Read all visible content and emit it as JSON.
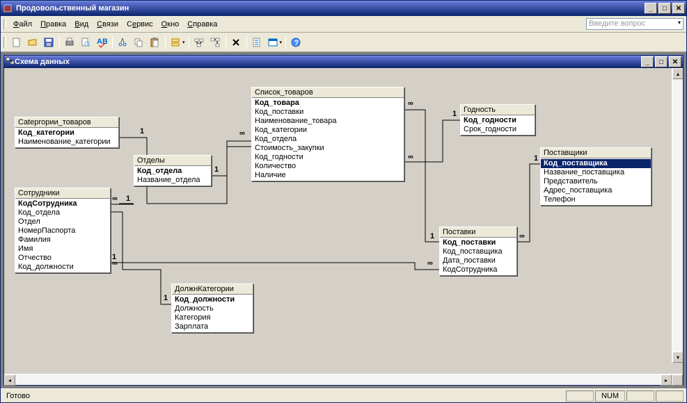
{
  "window": {
    "title": "Продовольственный магазин",
    "min": "_",
    "max": "□",
    "close": "✕"
  },
  "menu": {
    "items": [
      {
        "pre": "",
        "ul": "Ф",
        "post": "айл"
      },
      {
        "pre": "",
        "ul": "П",
        "post": "равка"
      },
      {
        "pre": "",
        "ul": "В",
        "post": "ид"
      },
      {
        "pre": "",
        "ul": "С",
        "post": "вязи"
      },
      {
        "pre": "С",
        "ul": "е",
        "post": "рвис"
      },
      {
        "pre": "",
        "ul": "О",
        "post": "кно"
      },
      {
        "pre": "",
        "ul": "С",
        "post": "правка"
      }
    ],
    "question_placeholder": "Введите вопрос"
  },
  "child": {
    "title": "Схема данных",
    "min": "_",
    "max": "□",
    "close": "✕"
  },
  "tables": {
    "cat": {
      "title": "Catергории_товаров",
      "fields": [
        "Код_категории",
        "Наименование_категории"
      ],
      "pk": [
        0
      ]
    },
    "otd": {
      "title": "Отделы",
      "fields": [
        "Код_отдела",
        "Название_отдела"
      ],
      "pk": [
        0
      ]
    },
    "sotr": {
      "title": "Сотрудники",
      "fields": [
        "КодСотрудника",
        "Код_отдела",
        "Отдел",
        "НомерПаспорта",
        "Фамилия",
        "Имя",
        "Отчество",
        "Код_должности"
      ],
      "pk": [
        0
      ]
    },
    "dolzh": {
      "title": "ДолжнКатегории",
      "fields": [
        "Код_должности",
        "Должность",
        "Категория",
        "Зарплата"
      ],
      "pk": [
        0
      ]
    },
    "tov": {
      "title": "Список_товаров",
      "fields": [
        "Код_товара",
        "Код_поставки",
        "Наименование_товара",
        "Код_категории",
        "Код_отдела",
        "Стоимость_закупки",
        "Код_годности",
        "Количество",
        "Наличие"
      ],
      "pk": [
        0
      ]
    },
    "post": {
      "title": "Поставки",
      "fields": [
        "Код_поставки",
        "Код_поставщика",
        "Дата_поставки",
        "КодСотрудника"
      ],
      "pk": [
        0
      ]
    },
    "godn": {
      "title": "Годность",
      "fields": [
        "Код_годности",
        "Срок_годности"
      ],
      "pk": [
        0
      ]
    },
    "pstav": {
      "title": "Поставщики",
      "fields": [
        "Код_поставщика",
        "Название_поставщика",
        "Представитель",
        "Адрес_поставщика",
        "Телефон"
      ],
      "pk": [
        0
      ],
      "sel": 0
    }
  },
  "status": {
    "ready": "Готово",
    "num": "NUM"
  },
  "rel_labels": {
    "one": "1",
    "many": "∞"
  }
}
